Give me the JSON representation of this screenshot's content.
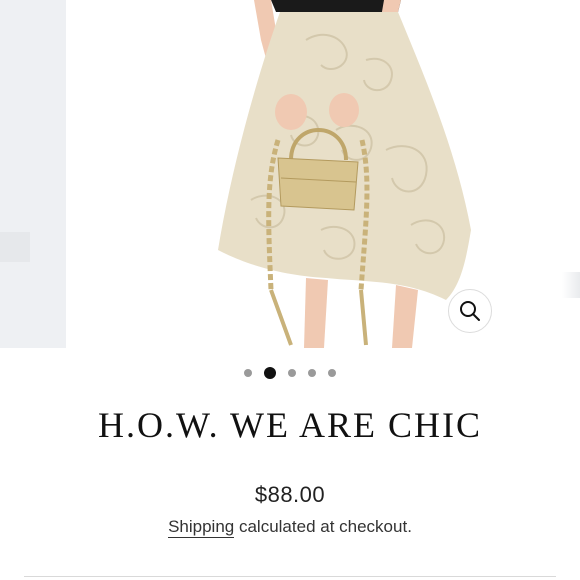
{
  "gallery": {
    "image_description_icon": "product-photo-skirt-and-bag",
    "zoom_icon": "magnifier-icon",
    "slide_count": 5,
    "active_slide": 2
  },
  "product": {
    "title": "H.O.W. WE ARE CHIC",
    "price": "$88.00",
    "shipping_link": "Shipping",
    "shipping_text": " calculated at checkout."
  },
  "colors": {
    "accent": "#111111",
    "dot_inactive": "#9a9a9a",
    "skirt": "#e8dfc8",
    "bag_gold": "#c9b27a"
  }
}
